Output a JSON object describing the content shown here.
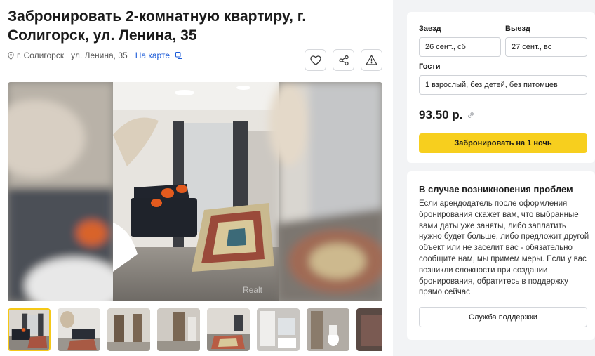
{
  "listing": {
    "title": "Забронировать 2-комнатную квартиру, г. Солигорск, ул. Ленина, 35",
    "city": "г. Солигорск",
    "street": "ул. Ленина, 35",
    "map_link": "На карте",
    "watermark": "Realt"
  },
  "icons": {
    "location": "location-pin-icon",
    "map": "map-copy-icon",
    "favorite": "heart-icon",
    "share": "share-icon",
    "report": "warning-triangle-icon",
    "price_link": "link-icon"
  },
  "thumbnails": [
    {
      "name": "thumb-1",
      "selected": true
    },
    {
      "name": "thumb-2",
      "selected": false
    },
    {
      "name": "thumb-3",
      "selected": false
    },
    {
      "name": "thumb-4",
      "selected": false
    },
    {
      "name": "thumb-5",
      "selected": false
    },
    {
      "name": "thumb-6",
      "selected": false
    },
    {
      "name": "thumb-7",
      "selected": false
    },
    {
      "name": "thumb-8",
      "selected": false
    }
  ],
  "booking": {
    "checkin_label": "Заезд",
    "checkout_label": "Выезд",
    "checkin_value": "26 сент., сб",
    "checkout_value": "27 сент., вс",
    "guests_label": "Гости",
    "guests_value": "1 взрослый, без детей, без питомцев",
    "price": "93.50 р.",
    "book_button": "Забронировать на 1 ночь"
  },
  "help": {
    "title": "В случае возникновения проблем",
    "text": "Если арендодатель после оформления бронирования скажет вам, что выбранные вами даты уже заняты, либо заплатить нужно будет больше, либо предложит другой объект или не заселит вас - обязательно сообщите нам, мы примем меры. Если у вас возникли сложности при создании бронирования, обратитесь в поддержку прямо сейчас",
    "support_button": "Служба поддержки"
  },
  "colors": {
    "accent_yellow": "#f7cf1e",
    "link_blue": "#1a5ad8",
    "sidebar_bg": "#f2f3f5"
  }
}
